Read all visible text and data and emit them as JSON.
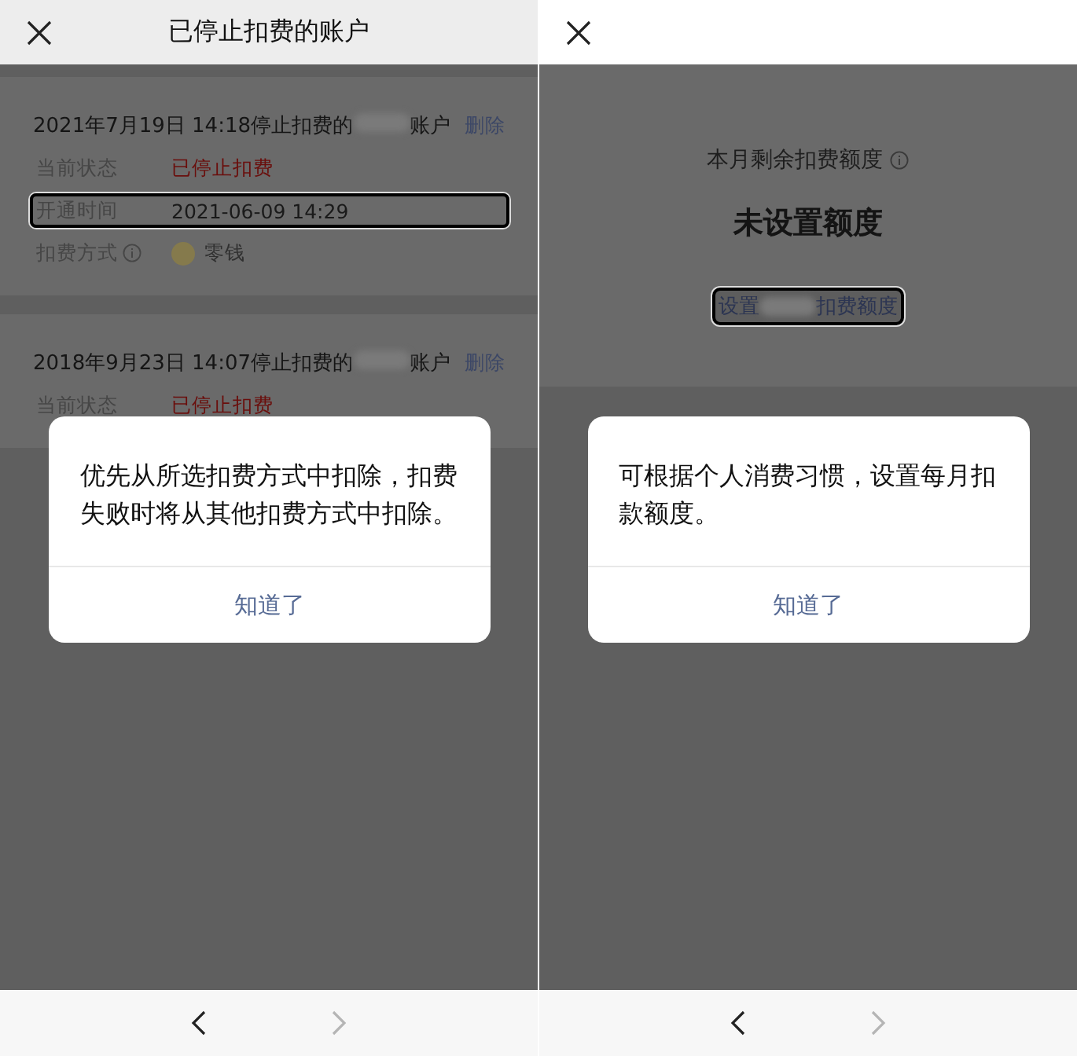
{
  "screens": [
    {
      "kind": "accounts",
      "header": {
        "title": "已停止扣费的账户"
      },
      "records": [
        {
          "title_before": "2021年7月19日 14:18停止扣费的",
          "title_after": "账户",
          "action": "删除",
          "rows": [
            {
              "kind": "status",
              "label": "当前状态",
              "value": "已停止扣费",
              "highlighted": false
            },
            {
              "kind": "text",
              "label": "开通时间",
              "value": "2021-06-09 14:29",
              "highlighted": true
            },
            {
              "kind": "payment",
              "label": "扣费方式",
              "value": "零钱",
              "highlighted": false
            }
          ]
        },
        {
          "title_before": "2018年9月23日 14:07停止扣费的",
          "title_after": "账户",
          "action": "删除",
          "rows": [
            {
              "kind": "status",
              "label": "当前状态",
              "value": "已停止扣费",
              "highlighted": false
            }
          ]
        }
      ],
      "dialog": {
        "message": "优先从所选扣费方式中扣除，扣费失败时将从其他扣费方式中扣除。",
        "button": "知道了"
      },
      "nav": [
        {
          "kind": "back",
          "enabled": true
        },
        {
          "kind": "forward",
          "enabled": false
        }
      ]
    },
    {
      "kind": "quota",
      "quota": {
        "label": "本月剩余扣费额度",
        "value": "未设置额度",
        "button_before": "设置",
        "button_after": "扣费额度",
        "highlighted": true
      },
      "dialog": {
        "message": "可根据个人消费习惯，设置每月扣款额度。",
        "button": "知道了"
      },
      "nav": [
        {
          "kind": "back",
          "enabled": true
        },
        {
          "kind": "forward",
          "enabled": false
        }
      ]
    }
  ]
}
